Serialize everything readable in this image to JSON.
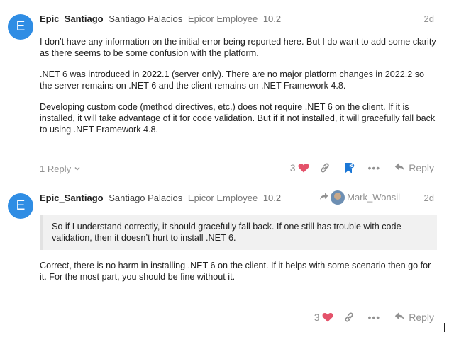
{
  "posts": [
    {
      "avatar_letter": "E",
      "username": "Epic_Santiago",
      "full_name": "Santiago Palacios",
      "user_title": "Epicor Employee",
      "flair": "10.2",
      "date": "2d",
      "paragraphs": [
        "I don’t have any information on the initial error being reported here. But I do want to add some clarity as there seems to be some confusion with the platform.",
        ".NET 6 was introduced in 2022.1 (server only). There are no major platform changes in 2022.2 so the server remains on .NET 6 and the client remains on .NET Framework 4.8.",
        "Developing custom code (method directives, etc.) does not require .NET 6 on the client. If it is installed, it will take advantage of it for code validation. But if it not installed, it will gracefully fall back to using .NET Framework 4.8."
      ],
      "replies_toggle": "1 Reply",
      "like_count": "3",
      "reply_label": "Reply"
    },
    {
      "avatar_letter": "E",
      "username": "Epic_Santiago",
      "full_name": "Santiago Palacios",
      "user_title": "Epicor Employee",
      "flair": "10.2",
      "date": "2d",
      "reply_to_user": "Mark_Wonsil",
      "quote": "So if I understand correctly, it should gracefully fall back. If one still has trouble with code validation, then it doesn’t hurt to install .NET 6.",
      "paragraphs": [
        "Correct, there is no harm in installing .NET 6 on the client. If it helps with some scenario then go for it. For the most part, you should be fine without it."
      ],
      "like_count": "3",
      "reply_label": "Reply"
    }
  ],
  "colors": {
    "avatar": "#2f8de4",
    "heart": "#e4526a",
    "bookmark": "#1b77d6",
    "muted": "#919191"
  },
  "icons": [
    "chevron-down-icon",
    "heart-icon",
    "link-icon",
    "bookmark-icon",
    "more-icon",
    "reply-arrow-icon"
  ]
}
